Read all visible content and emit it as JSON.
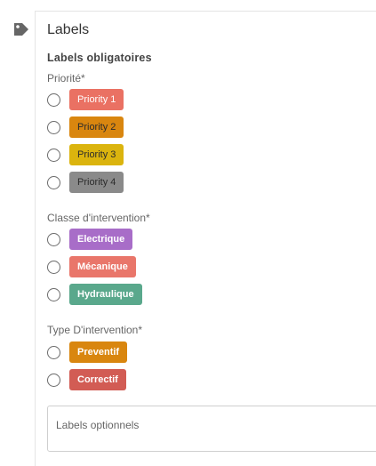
{
  "labels_panel": {
    "title": "Labels",
    "required_heading": "Labels obligatoires",
    "groups": [
      {
        "label": "Priorité*",
        "options": [
          {
            "text": "Priority 1",
            "color": "#ea7163"
          },
          {
            "text": "Priority 2",
            "color": "#d9860f"
          },
          {
            "text": "Priority 3",
            "color": "#dbb40e"
          },
          {
            "text": "Priority 4",
            "color": "#8a8a8a"
          }
        ]
      },
      {
        "label": "Classe d'intervention*",
        "options": [
          {
            "text": "Electrique",
            "color": "#a86dc8"
          },
          {
            "text": "Mécanique",
            "color": "#e9766a"
          },
          {
            "text": "Hydraulique",
            "color": "#5aa88c"
          }
        ]
      },
      {
        "label": "Type D'intervention*",
        "options": [
          {
            "text": "Preventif",
            "color": "#d9860f"
          },
          {
            "text": "Correctif",
            "color": "#d25c54"
          }
        ]
      }
    ],
    "optional_field": {
      "placeholder": "Labels optionnels"
    }
  },
  "icons": {
    "tag": "tag-icon"
  }
}
